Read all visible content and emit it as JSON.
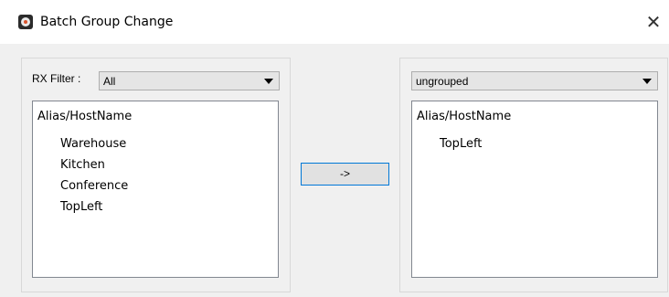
{
  "window": {
    "title": "Batch Group Change",
    "close_glyph": "✕"
  },
  "left_panel": {
    "filter_label": "RX Filter :",
    "filter_value": "All",
    "list_header": "Alias/HostName",
    "items": [
      "Warehouse",
      "Kitchen",
      "Conference",
      "TopLeft"
    ]
  },
  "move_button": {
    "label": "->"
  },
  "right_panel": {
    "group_value": "ungrouped",
    "list_header": "Alias/HostName",
    "items": [
      "TopLeft"
    ]
  },
  "colors": {
    "client_bg": "#f0f0f0",
    "button_border": "#0078d7",
    "listbox_border": "#828790"
  }
}
